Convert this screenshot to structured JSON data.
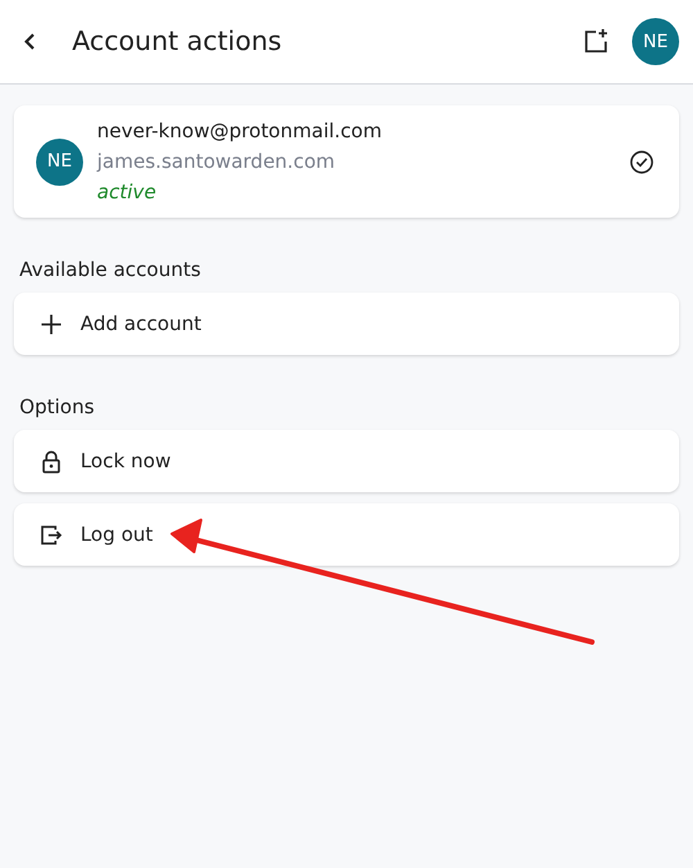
{
  "header": {
    "title": "Account actions",
    "avatar": "NE"
  },
  "account": {
    "avatar": "NE",
    "email": "never-know@protonmail.com",
    "domain": "james.santowarden.com",
    "status": "active",
    "selected": true
  },
  "sections": [
    {
      "title": "Available accounts",
      "items": [
        {
          "kind": "add",
          "label": "Add account"
        }
      ]
    },
    {
      "title": "Options",
      "items": [
        {
          "kind": "lock",
          "label": "Lock now"
        },
        {
          "kind": "logout",
          "label": "Log out"
        }
      ]
    }
  ],
  "annotation": {
    "kind": "arrow"
  }
}
